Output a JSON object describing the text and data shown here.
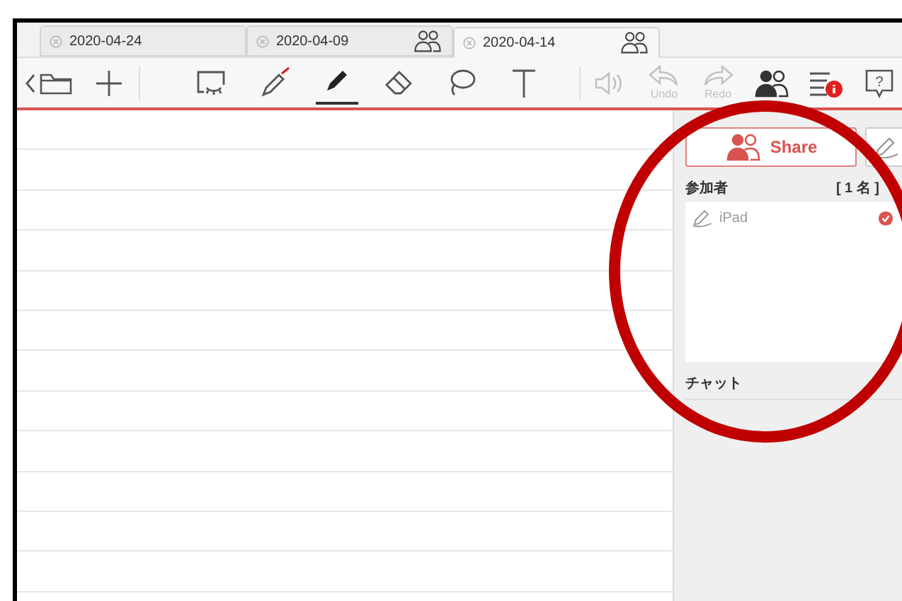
{
  "tabs": [
    {
      "label": "2020-04-24",
      "shared": false,
      "selected": false
    },
    {
      "label": "2020-04-09",
      "shared": true,
      "selected": false
    },
    {
      "label": "2020-04-14",
      "shared": true,
      "selected": true
    }
  ],
  "tools": [
    {
      "kind": "screen-capture",
      "selected": false
    },
    {
      "kind": "laser",
      "selected": false
    },
    {
      "kind": "marker",
      "selected": true
    },
    {
      "kind": "eraser",
      "selected": false
    },
    {
      "kind": "lasso",
      "selected": false
    },
    {
      "kind": "text",
      "selected": false
    }
  ],
  "actions": [
    {
      "kind": "speaker",
      "disabled": true
    },
    {
      "kind": "undo",
      "label": "Undo",
      "disabled": true
    },
    {
      "kind": "redo",
      "label": "Redo",
      "disabled": true
    },
    {
      "kind": "share",
      "disabled": false
    },
    {
      "kind": "list",
      "disabled": false
    },
    {
      "kind": "help",
      "glyph": "?",
      "disabled": false
    }
  ],
  "panel": {
    "share_button": "Share",
    "participants_label": "参加者",
    "participants_count": "[ 1 名 ]",
    "participants": [
      {
        "name": "iPad",
        "checked": true
      }
    ],
    "chat_label": "チャット"
  }
}
